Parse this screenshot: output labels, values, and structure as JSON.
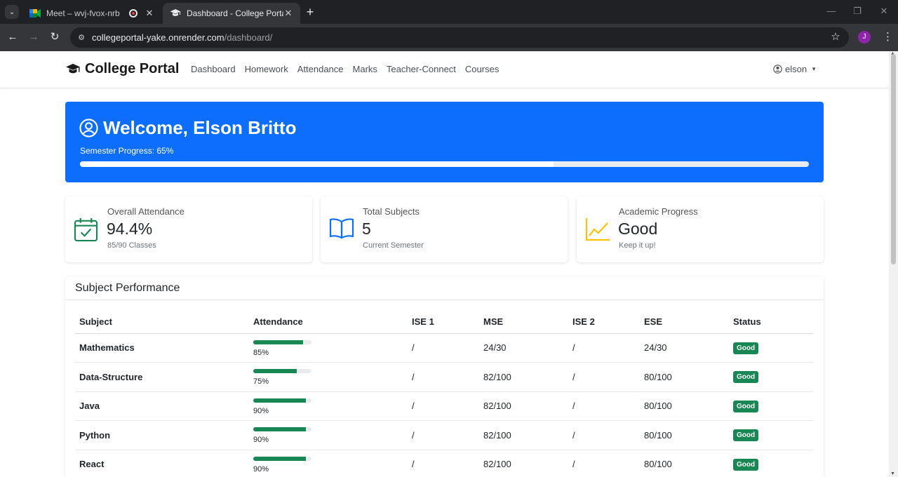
{
  "browser": {
    "tabs": [
      {
        "title": "Meet – wvj-fvox-nrb",
        "active": false
      },
      {
        "title": "Dashboard - College Portal",
        "active": true
      }
    ],
    "url_host": "collegeportal-yake.onrender.com",
    "url_path": "/dashboard/",
    "profile_initial": "J"
  },
  "navbar": {
    "brand": "College Portal",
    "links": [
      "Dashboard",
      "Homework",
      "Attendance",
      "Marks",
      "Teacher-Connect",
      "Courses"
    ],
    "user": "elson"
  },
  "welcome": {
    "title": "Welcome, Elson Britto",
    "progress_label": "Semester Progress: 65%",
    "progress_value": 0.65
  },
  "stats": [
    {
      "label": "Overall Attendance",
      "value": "94.4%",
      "sub": "85/90 Classes",
      "icon": "calendar-check-icon",
      "color": "#198754"
    },
    {
      "label": "Total Subjects",
      "value": "5",
      "sub": "Current Semester",
      "icon": "book-icon",
      "color": "#0d6efd"
    },
    {
      "label": "Academic Progress",
      "value": "Good",
      "sub": "Keep it up!",
      "icon": "chart-line-icon",
      "color": "#ffc107"
    }
  ],
  "performance": {
    "title": "Subject Performance",
    "columns": [
      "Subject",
      "Attendance",
      "ISE 1",
      "MSE",
      "ISE 2",
      "ESE",
      "Status"
    ],
    "rows": [
      {
        "subject": "Mathematics",
        "attendance": "85%",
        "attendance_value": 0.85,
        "ise1": "/",
        "mse": "24/30",
        "ise2": "/",
        "ese": "24/30",
        "status": "Good"
      },
      {
        "subject": "Data-Structure",
        "attendance": "75%",
        "attendance_value": 0.75,
        "ise1": "/",
        "mse": "82/100",
        "ise2": "/",
        "ese": "80/100",
        "status": "Good"
      },
      {
        "subject": "Java",
        "attendance": "90%",
        "attendance_value": 0.9,
        "ise1": "/",
        "mse": "82/100",
        "ise2": "/",
        "ese": "80/100",
        "status": "Good"
      },
      {
        "subject": "Python",
        "attendance": "90%",
        "attendance_value": 0.9,
        "ise1": "/",
        "mse": "82/100",
        "ise2": "/",
        "ese": "80/100",
        "status": "Good"
      },
      {
        "subject": "React",
        "attendance": "90%",
        "attendance_value": 0.9,
        "ise1": "/",
        "mse": "82/100",
        "ise2": "/",
        "ese": "80/100",
        "status": "Good"
      }
    ]
  },
  "colors": {
    "primary": "#0d6efd",
    "success": "#198754",
    "warning": "#ffc107"
  }
}
